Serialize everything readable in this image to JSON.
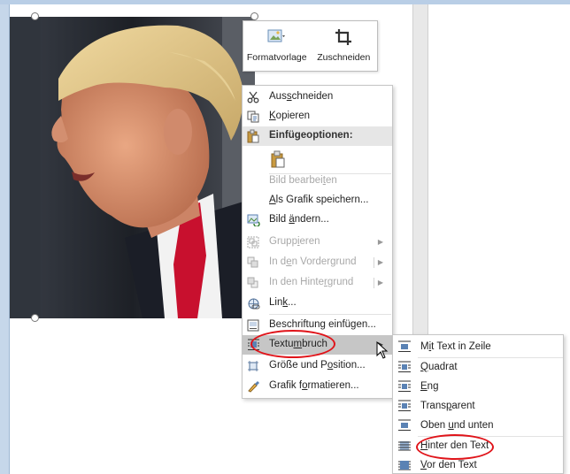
{
  "mini_toolbar": {
    "style_label": "Formatvorlage",
    "crop_label": "Zuschneiden"
  },
  "context_menu": {
    "items": [
      {
        "label": "Ausschneiden",
        "icon": "scissors-icon"
      },
      {
        "label": "Kopieren",
        "icon": "copy-icon"
      },
      {
        "label": "Einfügeoptionen:",
        "icon": "paste-icon"
      },
      {
        "label": "",
        "icon": "paste-option-icon"
      },
      {
        "label": "Bild bearbeiten",
        "icon": ""
      },
      {
        "label": "Als Grafik speichern...",
        "icon": ""
      },
      {
        "label": "Bild ändern...",
        "icon": "change-picture-icon"
      },
      {
        "label": "Gruppieren",
        "icon": "group-icon"
      },
      {
        "label": "In den Vordergrund",
        "icon": "bring-forward-icon"
      },
      {
        "label": "In den Hintergrund",
        "icon": "send-backward-icon"
      },
      {
        "label": "Link...",
        "icon": "link-icon"
      },
      {
        "label": "Beschriftung einfügen...",
        "icon": "caption-icon"
      },
      {
        "label": "Textumbruch",
        "icon": "wrap-text-icon"
      },
      {
        "label": "Größe und Position...",
        "icon": "size-position-icon"
      },
      {
        "label": "Grafik formatieren...",
        "icon": "format-picture-icon"
      }
    ]
  },
  "wrap_submenu": {
    "items": [
      {
        "label": "Mit Text in Zeile"
      },
      {
        "label": "Quadrat"
      },
      {
        "label": "Eng"
      },
      {
        "label": "Transparent"
      },
      {
        "label": "Oben und unten"
      },
      {
        "label": "Hinter den Text"
      },
      {
        "label": "Vor den Text"
      }
    ]
  },
  "colors": {
    "highlight_oval": "#e0141a",
    "menu_hover": "#c6c6c6",
    "window_frame": "#b9cee6"
  }
}
